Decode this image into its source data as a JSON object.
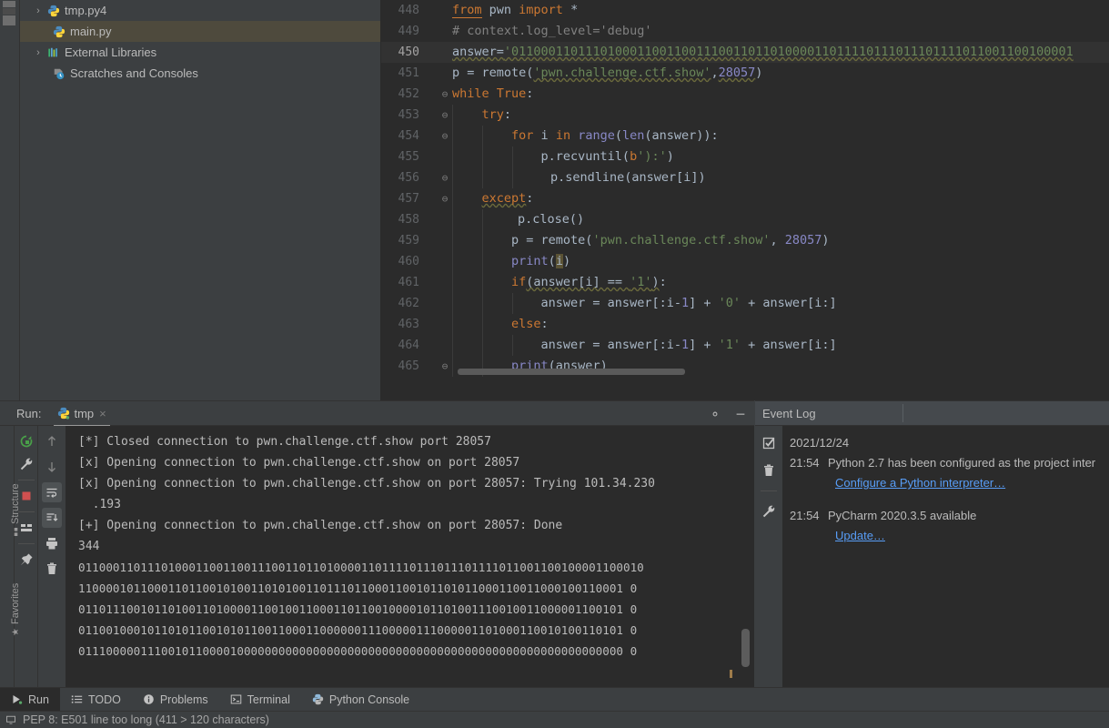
{
  "project_tree": {
    "items": [
      {
        "label": "tmp.py4",
        "icon": "python-file-icon",
        "arrow": "›",
        "selected": false,
        "indent": 0
      },
      {
        "label": "main.py",
        "icon": "python-file-icon",
        "arrow": "",
        "selected": true,
        "indent": 1
      },
      {
        "label": "External Libraries",
        "icon": "libraries-icon",
        "arrow": "›",
        "selected": false,
        "indent": 0
      },
      {
        "label": "Scratches and Consoles",
        "icon": "scratches-icon",
        "arrow": "",
        "selected": false,
        "indent": 1
      }
    ]
  },
  "editor": {
    "first_line": 448,
    "current_line": 450,
    "lines": [
      {
        "n": "448",
        "fold": ""
      },
      {
        "n": "449",
        "fold": ""
      },
      {
        "n": "450",
        "fold": ""
      },
      {
        "n": "451",
        "fold": ""
      },
      {
        "n": "452",
        "fold": "⊖"
      },
      {
        "n": "453",
        "fold": "⊖"
      },
      {
        "n": "454",
        "fold": "⊖"
      },
      {
        "n": "455",
        "fold": ""
      },
      {
        "n": "456",
        "fold": "⊖"
      },
      {
        "n": "457",
        "fold": "⊖"
      },
      {
        "n": "458",
        "fold": ""
      },
      {
        "n": "459",
        "fold": ""
      },
      {
        "n": "460",
        "fold": ""
      },
      {
        "n": "461",
        "fold": ""
      },
      {
        "n": "462",
        "fold": ""
      },
      {
        "n": "463",
        "fold": ""
      },
      {
        "n": "464",
        "fold": ""
      },
      {
        "n": "465",
        "fold": "⊖"
      }
    ],
    "code": {
      "l448": "from pwn import *",
      "l449": "# context.log_level='debug'",
      "l450_var": "answer=",
      "l450_str": "'0110001101110100011001100111001101101000011011110111011101111011001100100001",
      "l451": "p = remote('pwn.challenge.ctf.show',28057)",
      "l451_host": "'pwn.challenge.ctf.show'",
      "l451_port": "28057",
      "l452": "while True:",
      "l453": "try:",
      "l454": "for i in range(len(answer)):",
      "l455": "p.recvuntil(b'):')",
      "l456": "p.sendline(answer[i])",
      "l457": "except:",
      "l458": "p.close()",
      "l459": "p = remote('pwn.challenge.ctf.show', 28057)",
      "l460": "print(i)",
      "l461": "if(answer[i] == '1'):",
      "l462": "answer = answer[:i-1] + '0' + answer[i:]",
      "l463": "else:",
      "l464": "answer = answer[:i-1] + '1' + answer[i:]",
      "l465": "print(answer)"
    }
  },
  "run_window": {
    "run_label": "Run:",
    "tab_name": "tmp",
    "tab_close": "×",
    "settings_icon": "gear-icon",
    "minimize_icon": "minimize-icon",
    "side_tabs": [
      "Structure",
      "Favorites"
    ],
    "toolbar_icons": [
      "rerun-icon",
      "wrench-icon",
      "stop-icon",
      "layout-icon",
      "pin-icon"
    ],
    "toolbar2_icons": [
      "arrow-up-icon",
      "arrow-down-icon",
      "soft-wrap-icon",
      "scroll-to-end-icon",
      "print-icon",
      "trash-icon"
    ],
    "console_lines": [
      "[*] Closed connection to pwn.challenge.ctf.show port 28057",
      "[x] Opening connection to pwn.challenge.ctf.show on port 28057",
      "[x] Opening connection to pwn.challenge.ctf.show on port 28057: Trying 101.34.230",
      "  .193",
      "[+] Opening connection to pwn.challenge.ctf.show on port 28057: Done",
      "344"
    ],
    "binary_lines": [
      "01100011011101000110011001110011011010000110111101110111011110110011001000011000 10",
      "11000010110001101100101001101010011011101100011001011010110001100110001001100010",
      "01101110010110100110100001100100110001101100100001011010011100100110000011001010",
      "01100100010110101100101011001100011000000111000001110000011010001100101001101010",
      "01110000011100101100001000000000000000000000000000000000000000000000000000000000"
    ],
    "binary_lines_display": [
      "0110001101110100011001100111001101101000011011110111011101111011001100100001100010",
      "1100001011000110110010100110101001101110110001100101101011000110011000100110001 0",
      "0110111001011010011010000110010011000110110010000101101001110010011000001100101 0",
      "0110010001011010110010101100110001100000011100000111000001101000110010100110101 0",
      "0111000001110010110000100000000000000000000000000000000000000000000000000000000 0"
    ]
  },
  "event_log": {
    "title": "Event Log",
    "toolbar_icons": [
      "mark-read-icon",
      "trash-icon",
      "wrench-icon"
    ],
    "date": "2021/12/24",
    "entries": [
      {
        "time": "21:54",
        "message": "Python 2.7 has been configured as the project inter",
        "link": "Configure a Python interpreter…"
      },
      {
        "time": "21:54",
        "message": "PyCharm 2020.3.5 available",
        "link": "Update…"
      }
    ]
  },
  "bottom_toolbar": {
    "items": [
      {
        "label": "Run",
        "icon": "run-icon",
        "active": true
      },
      {
        "label": "TODO",
        "icon": "todo-icon",
        "active": false
      },
      {
        "label": "Problems",
        "icon": "problems-icon",
        "active": false
      },
      {
        "label": "Terminal",
        "icon": "terminal-icon",
        "active": false
      },
      {
        "label": "Python Console",
        "icon": "python-console-icon",
        "active": false
      }
    ]
  },
  "status_bar": {
    "icon": "inspection-icon",
    "message": "PEP 8: E501 line too long (411 > 120 characters)"
  },
  "colors": {
    "panel_bg": "#3c3f41",
    "editor_bg": "#2b2b2b",
    "selection": "#4e4a3d",
    "link": "#589df6",
    "keyword": "#cc7832",
    "string": "#6a8759",
    "text": "#a9b7c6",
    "comment": "#808080",
    "function": "#ffc66d",
    "builtin": "#8888c6",
    "stop_red": "#d05050",
    "run_green": "#499c54"
  }
}
